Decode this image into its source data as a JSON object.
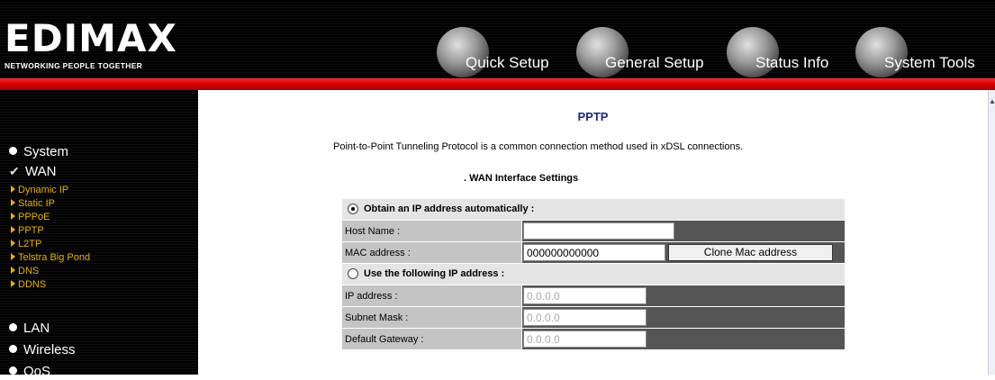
{
  "header": {
    "logo": "EDIMAX",
    "tagline": "NETWORKING PEOPLE TOGETHER",
    "nav": [
      {
        "label": "Quick Setup"
      },
      {
        "label": "General Setup"
      },
      {
        "label": "Status Info"
      },
      {
        "label": "System Tools"
      }
    ]
  },
  "sidebar": {
    "items": [
      {
        "label": "System",
        "icon": "bullet-icon"
      },
      {
        "label": "WAN",
        "icon": "check-icon"
      },
      {
        "label": "LAN",
        "icon": "bullet-icon"
      },
      {
        "label": "Wireless",
        "icon": "bullet-icon"
      },
      {
        "label": "QoS",
        "icon": "bullet-icon"
      }
    ],
    "wan_sub": [
      "Dynamic IP",
      "Static IP",
      "PPPoE",
      "PPTP",
      "L2TP",
      "Telstra Big Pond",
      "DNS",
      "DDNS"
    ]
  },
  "main": {
    "title": "PPTP",
    "description": "Point-to-Point Tunneling Protocol is a common connection method used in xDSL connections.",
    "section_title": ". WAN Interface Settings",
    "obtain_auto_label": "Obtain an IP address automatically :",
    "host_name_label": "Host Name :",
    "host_name_value": "",
    "mac_label": "MAC address :",
    "mac_value": "000000000000",
    "clone_mac_button": "Clone Mac address",
    "use_following_label": "Use the following IP address :",
    "ip_label": "IP address :",
    "ip_value": "0.0.0.0",
    "subnet_label": "Subnet Mask :",
    "subnet_value": "0.0.0.0",
    "gateway_label": "Default Gateway :",
    "gateway_value": "0.0.0.0"
  },
  "colors": {
    "red_bar": "#d40000",
    "sub_item": "#e8b000",
    "title": "#1a2a80"
  }
}
